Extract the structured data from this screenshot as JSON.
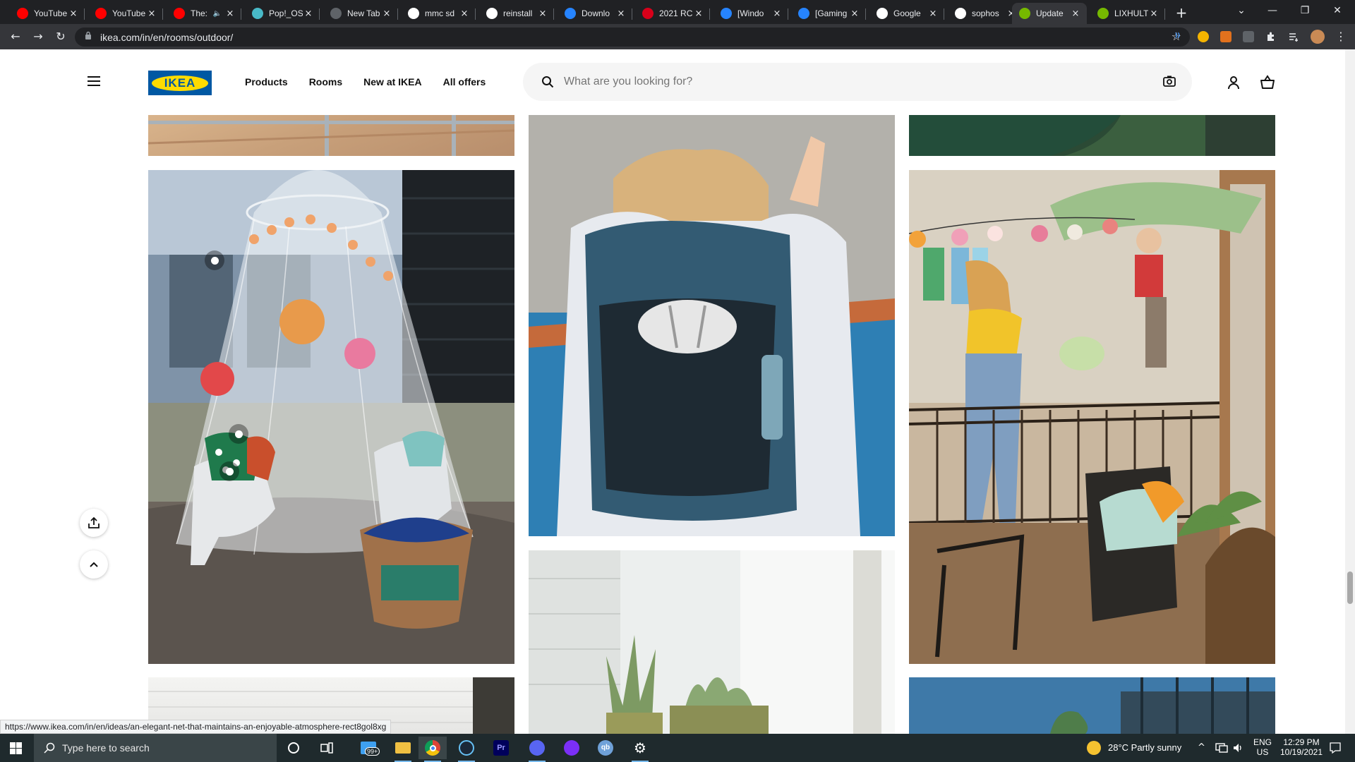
{
  "browser": {
    "tabs": [
      {
        "label": "YouTube",
        "icon": "youtube-icon",
        "audio": false
      },
      {
        "label": "YouTube",
        "icon": "youtube-icon",
        "audio": false
      },
      {
        "label": "The:",
        "icon": "youtube-icon",
        "audio": true
      },
      {
        "label": "Pop!_OS",
        "icon": "popos-icon",
        "audio": false
      },
      {
        "label": "New Tab",
        "icon": "chrome-icon",
        "audio": false
      },
      {
        "label": "mmc sd",
        "icon": "github-icon",
        "audio": false
      },
      {
        "label": "reinstall",
        "icon": "google-icon",
        "audio": false
      },
      {
        "label": "Downlo",
        "icon": "atlassian-icon",
        "audio": false
      },
      {
        "label": "2021 RC",
        "icon": "rog-icon",
        "audio": false
      },
      {
        "label": "[Windo",
        "icon": "atlassian-icon",
        "audio": false
      },
      {
        "label": "[Gaming",
        "icon": "atlassian-icon",
        "audio": false
      },
      {
        "label": "Google",
        "icon": "google-icon",
        "audio": false
      },
      {
        "label": "sophos",
        "icon": "google-icon",
        "audio": false
      },
      {
        "label": "Update",
        "icon": "nvidia-icon",
        "audio": false,
        "active": true
      },
      {
        "label": "LIXHULT",
        "icon": "nvidia-icon",
        "audio": false
      }
    ],
    "url": "ikea.com/in/en/rooms/outdoor/",
    "status_url": "https://www.ikea.com/in/en/ideas/an-elegant-net-that-maintains-an-enjoyable-atmosphere-rect8gol8xg"
  },
  "ikea": {
    "logo_text": "IKEA",
    "nav": [
      "Products",
      "Rooms",
      "New at IKEA",
      "All offers"
    ],
    "search_placeholder": "What are you looking for?",
    "colors": {
      "brand_blue": "#0058a3",
      "brand_yellow": "#ffdb00"
    }
  },
  "taskbar": {
    "search_placeholder": "Type here to search",
    "weather": "28°C  Partly sunny",
    "language_top": "ENG",
    "language_bottom": "US",
    "time": "12:29 PM",
    "date": "10/19/2021",
    "mail_badge": "99+"
  }
}
